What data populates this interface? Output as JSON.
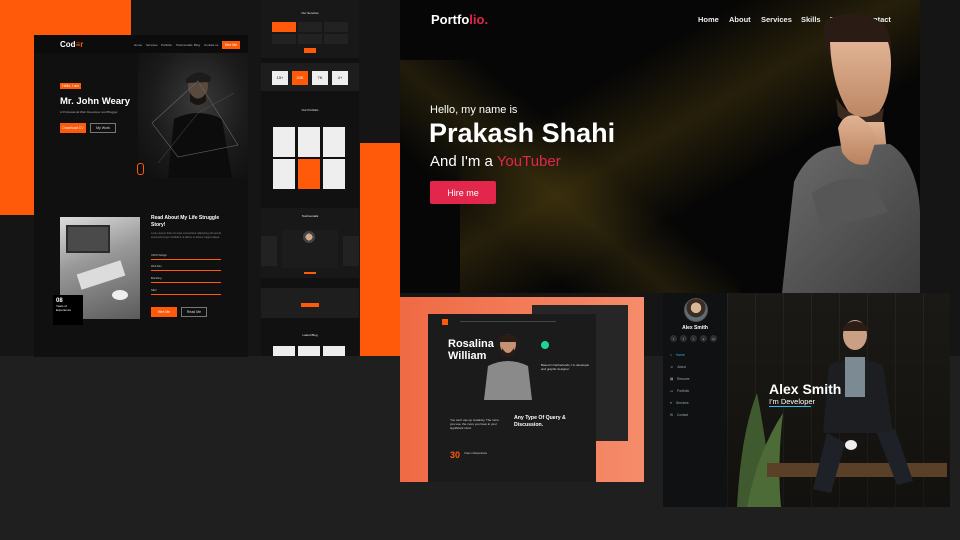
{
  "coder": {
    "logo_a": "Cod",
    "logo_b": "≡r",
    "nav": [
      "Home",
      "Services",
      "Portfolio",
      "Testimonials",
      "Blog",
      "Contact us"
    ],
    "nav_button": "Hire Me",
    "tag": "Hello, I am",
    "name": "Mr. John Weary",
    "subtitle": "A Professional Web Developer and Blogger",
    "primary_button": "Download CV",
    "secondary_button": "My Work",
    "story_title": "Read About My Life Struggle Story!",
    "story_text": "Lorem ipsum dolor sit amet consectetur adipiscing elit sed do eiusmod tempor incididunt ut labore et dolore magna aliqua.",
    "skills": [
      "UI/UX Design",
      "Web Dev",
      "Branding",
      "SEO"
    ],
    "experience_number": "08",
    "experience_label": "Years of Experience",
    "form_primary": "Hire Me",
    "form_secondary": "Read Me"
  },
  "strip": {
    "services_title": "Our Services",
    "stats": [
      "15+",
      "20K",
      "7K",
      "4+"
    ],
    "portfolio_title": "Our Portfolio",
    "testimonials_title": "Testimonials",
    "blog_title": "Latest Blog"
  },
  "hero": {
    "logo_main": "Portfo",
    "logo_accent": "lio.",
    "menu": [
      "Home",
      "About",
      "Services",
      "Skills",
      "Teams",
      "Contact"
    ],
    "greeting": "Hello, my name is",
    "name": "Prakash Shahi",
    "role_prefix": "And I'm a ",
    "role": "YouTuber",
    "cta": "Hire me",
    "accent_color": "#e3264b"
  },
  "rosalina": {
    "name_line1": "Rosalina",
    "name_line2": "William",
    "intro": "Based in Netherlands, I'm developer and graphic designer.",
    "quote_text": "You can't use up creativity. The more you use, the more you have in your significant mind.",
    "cta_title": "Any Type Of Query & Discussion.",
    "years": "30",
    "years_label": "Years of Experience",
    "accent_color": "#ff5a0a"
  },
  "alex": {
    "sidebar_name": "Alex Smith",
    "social": [
      "t",
      "f",
      "i",
      "s",
      "in"
    ],
    "menu": [
      "Home",
      "About",
      "Resume",
      "Portfolio",
      "Services",
      "Contact"
    ],
    "hero_name": "Alex Smith",
    "hero_role": "I'm Developer",
    "accent_color": "#2fb7e6"
  }
}
